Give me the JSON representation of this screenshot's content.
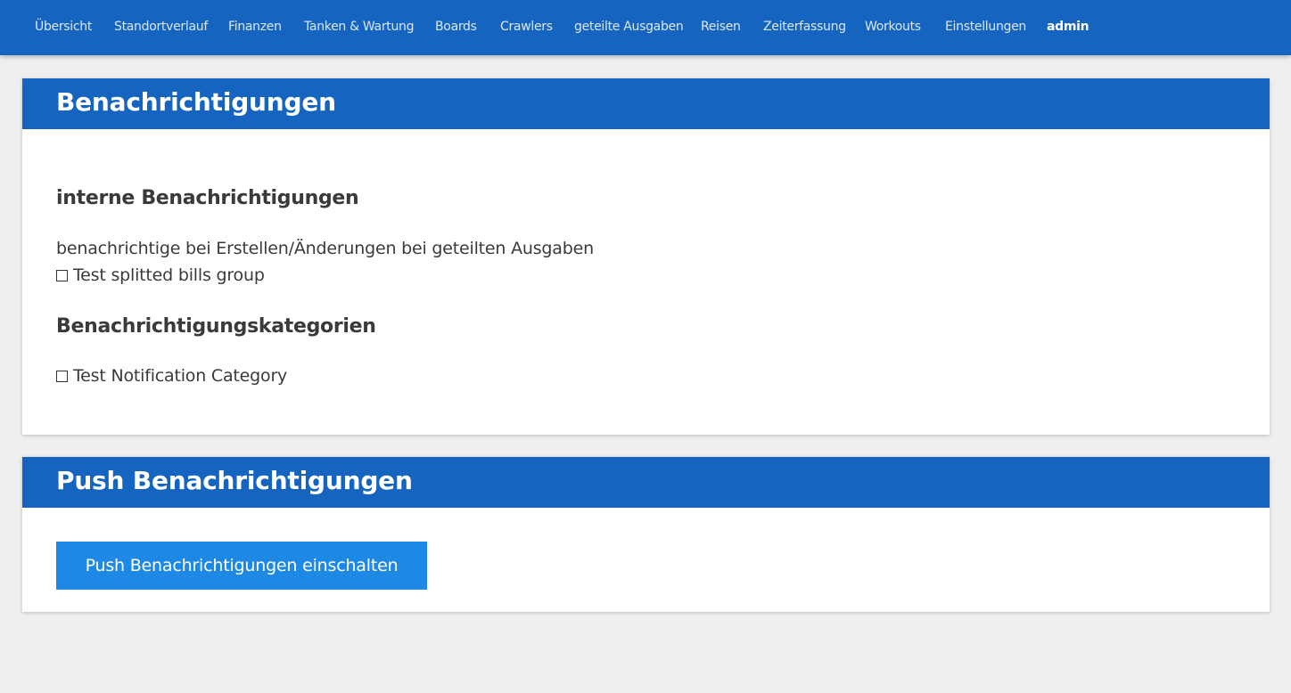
{
  "nav": {
    "items": [
      {
        "label": "Übersicht"
      },
      {
        "label": "Standortverlauf"
      },
      {
        "label": "Finanzen"
      },
      {
        "label": "Tanken & Wartung"
      },
      {
        "label": "Boards"
      },
      {
        "label": "Crawlers"
      },
      {
        "label": "geteilte Ausgaben"
      },
      {
        "label": "Reisen"
      },
      {
        "label": "Zeiterfassung"
      },
      {
        "label": "Workouts"
      },
      {
        "label": "Einstellungen"
      },
      {
        "label": "admin"
      }
    ]
  },
  "notifications_card": {
    "title": "Benachrichtigungen",
    "internal_heading": "interne Benachrichtigungen",
    "splitted_bills_description": "benachrichtige bei Erstellen/Änderungen bei geteilten Ausgaben",
    "splitted_bills_group": {
      "label": "Test splitted bills group",
      "checked": false
    },
    "categories_heading": "Benachrichtigungskategorien",
    "category": {
      "label": "Test Notification Category",
      "checked": false
    }
  },
  "push_card": {
    "title": "Push Benachrichtigungen",
    "button_label": "Push Benachrichtigungen einschalten"
  }
}
